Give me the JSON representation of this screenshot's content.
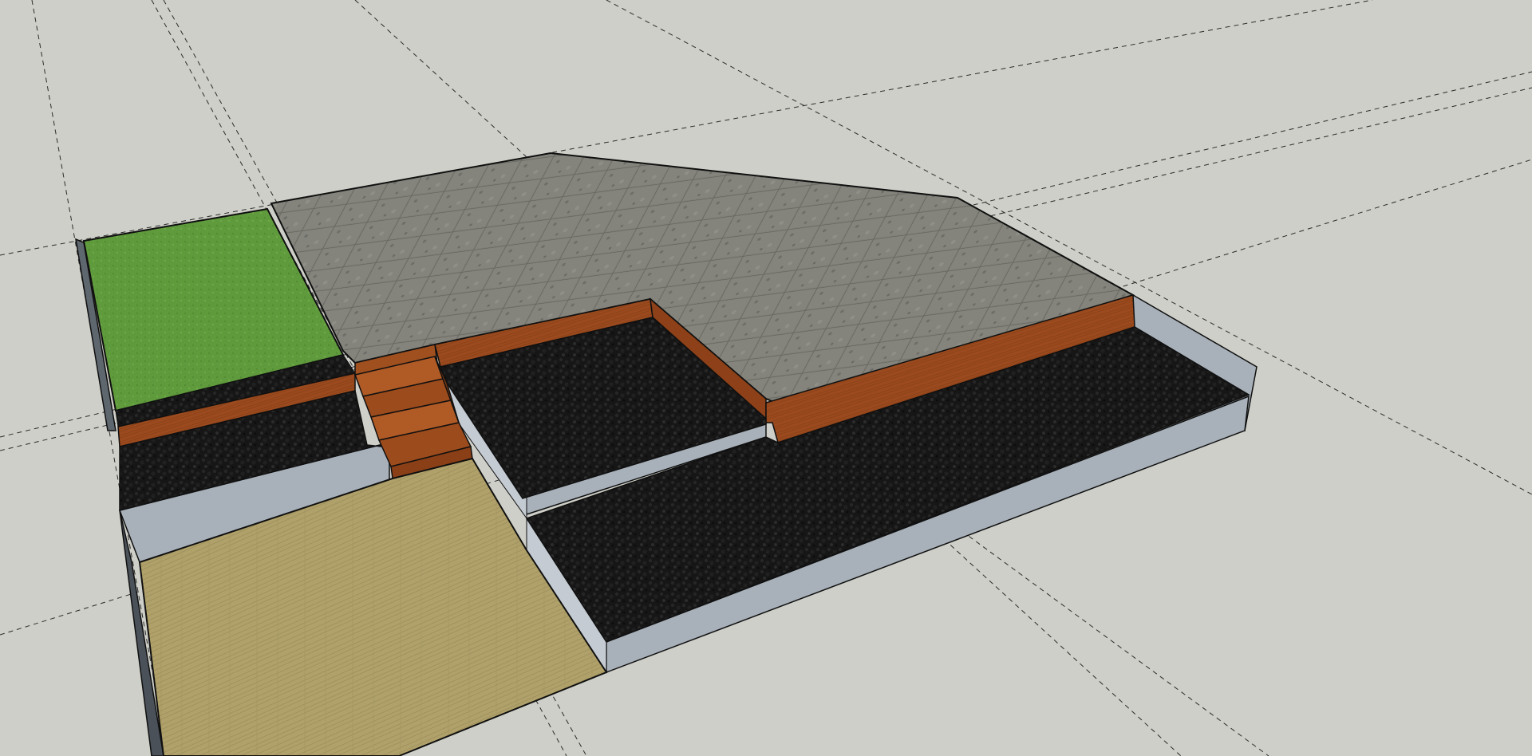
{
  "app": {
    "view": "3d-modeling-viewport",
    "background_color": "#cfcfc9"
  },
  "scene": {
    "materials": {
      "paving": "#7d7d76",
      "paving_line": "#62625c",
      "grass": "#5f9a3c",
      "mulch": "#161616",
      "wood_wall": "#9a4a1e",
      "wood_step": "#8f4419",
      "deck": "#b0a16a",
      "deck_grain": "#988a58",
      "side_wall": "#a8b1ba",
      "side_wall_dark": "#5e666e",
      "edge": "#101010",
      "guide": "#2b2b2b"
    },
    "objects": [
      "guide-lines",
      "paving-terrace",
      "lawn-bed",
      "retaining-walls",
      "mulch-beds",
      "timber-steps",
      "timber-deck",
      "foundation-walls"
    ]
  }
}
